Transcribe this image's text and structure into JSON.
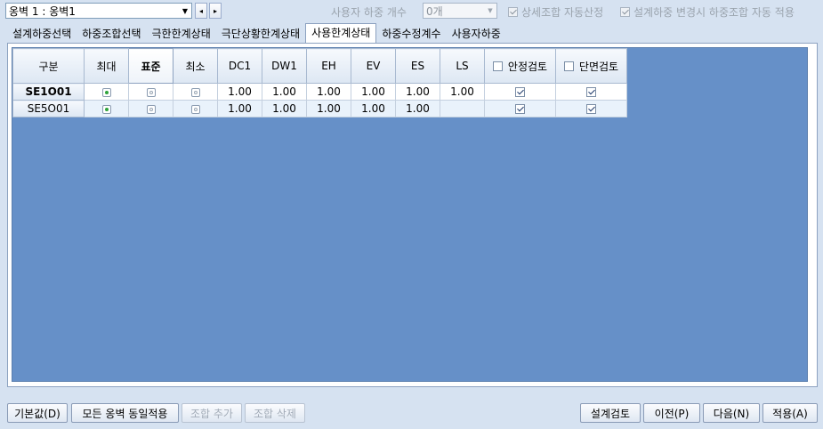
{
  "topbar": {
    "wall_select_value": "옹벽 1 : 옹벽1",
    "prev_label": "◂",
    "next_label": "▸",
    "user_load_count_label": "사용자 하중 개수",
    "user_load_count_value": "0개",
    "opt_auto_detail": "상세조합 자동산정",
    "opt_auto_apply": "설계하중 변경시 하중조합 자동 적용"
  },
  "tabs": [
    {
      "label": "설계하중선택"
    },
    {
      "label": "하중조합선택"
    },
    {
      "label": "극한한계상태"
    },
    {
      "label": "극단상황한계상태"
    },
    {
      "label": "사용한계상태"
    },
    {
      "label": "하중수정계수"
    },
    {
      "label": "사용자하중"
    }
  ],
  "grid": {
    "headers": [
      "구분",
      "최대",
      "표준",
      "최소",
      "DC1",
      "DW1",
      "EH",
      "EV",
      "ES",
      "LS",
      "안정검토",
      "단면검토"
    ],
    "rows": [
      {
        "name": "SE1O01",
        "max": true,
        "std": false,
        "min": false,
        "DC1": "1.00",
        "DW1": "1.00",
        "EH": "1.00",
        "EV": "1.00",
        "ES": "1.00",
        "LS": "1.00",
        "stability": true,
        "section": true
      },
      {
        "name": "SE5O01",
        "max": true,
        "std": false,
        "min": false,
        "DC1": "1.00",
        "DW1": "1.00",
        "EH": "1.00",
        "EV": "1.00",
        "ES": "1.00",
        "LS": "",
        "stability": true,
        "section": true
      }
    ]
  },
  "buttons": {
    "default": "기본값(D)",
    "apply_all": "모든 옹벽 동일적용",
    "add_combo": "조합 추가",
    "delete_combo": "조합 삭제",
    "design_check": "설계검토",
    "prev": "이전(P)",
    "next": "다음(N)",
    "apply": "적용(A)"
  },
  "colors": {
    "grid_background": "#6690c8",
    "window_background": "#d6e2f1",
    "radio_on": "#2fa43a"
  }
}
